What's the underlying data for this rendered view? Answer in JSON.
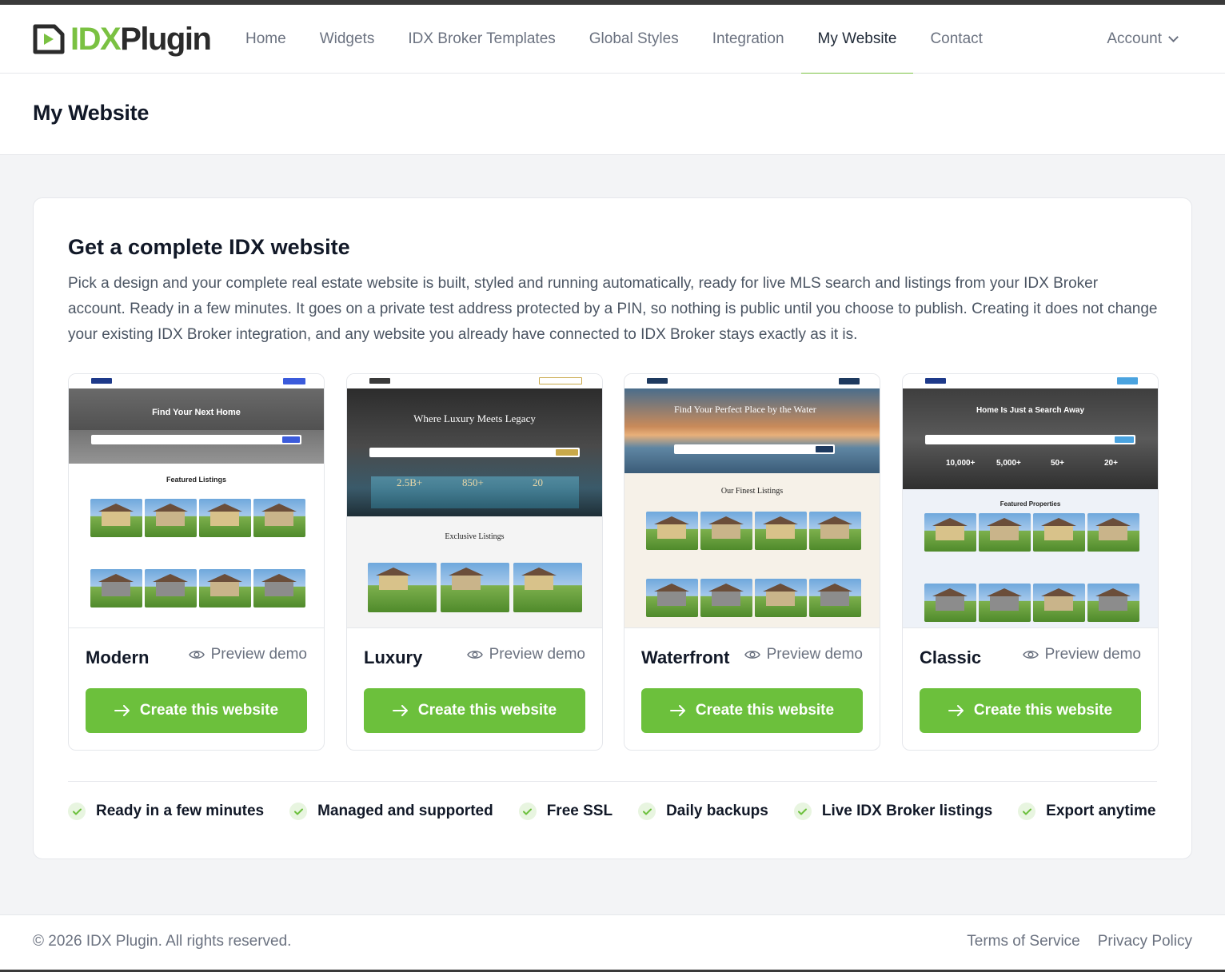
{
  "brand": {
    "logo_part1": "IDX",
    "logo_part2": "Plugin",
    "accent": "#7ac142"
  },
  "nav": {
    "items": [
      {
        "label": "Home",
        "active": false
      },
      {
        "label": "Widgets",
        "active": false
      },
      {
        "label": "IDX Broker Templates",
        "active": false
      },
      {
        "label": "Global Styles",
        "active": false
      },
      {
        "label": "Integration",
        "active": false
      },
      {
        "label": "My Website",
        "active": true
      },
      {
        "label": "Contact",
        "active": false
      }
    ],
    "account_label": "Account"
  },
  "page": {
    "title": "My Website"
  },
  "panel": {
    "title": "Get a complete IDX website",
    "description": "Pick a design and your complete real estate website is built, styled and running automatically, ready for live MLS search and listings from your IDX Broker account. Ready in a few minutes. It goes on a private test address protected by a PIN, so nothing is public until you choose to publish. Creating it does not change your existing IDX Broker integration, and any website you already have connected to IDX Broker stays exactly as it is.",
    "preview_label": "Preview demo",
    "create_label": "Create this website",
    "templates": [
      {
        "name": "Modern",
        "hero_title": "Find Your Next Home",
        "section_title": "Featured Listings"
      },
      {
        "name": "Luxury",
        "hero_title": "Where Luxury Meets Legacy",
        "section_title": "Exclusive Listings",
        "stats": [
          "2.5B+",
          "850+",
          "20"
        ]
      },
      {
        "name": "Waterfront",
        "hero_title": "Find Your Perfect Place by the Water",
        "section_title": "Our Finest Listings"
      },
      {
        "name": "Classic",
        "hero_title": "Home Is Just a Search Away",
        "section_title": "Featured Properties",
        "stats": [
          "10,000+",
          "5,000+",
          "50+",
          "20+"
        ]
      }
    ],
    "features": [
      "Ready in a few minutes",
      "Managed and supported",
      "Free SSL",
      "Daily backups",
      "Live IDX Broker listings",
      "Export anytime"
    ]
  },
  "footer": {
    "copyright": "© 2026 IDX Plugin. All rights reserved.",
    "links": [
      "Terms of Service",
      "Privacy Policy"
    ]
  }
}
